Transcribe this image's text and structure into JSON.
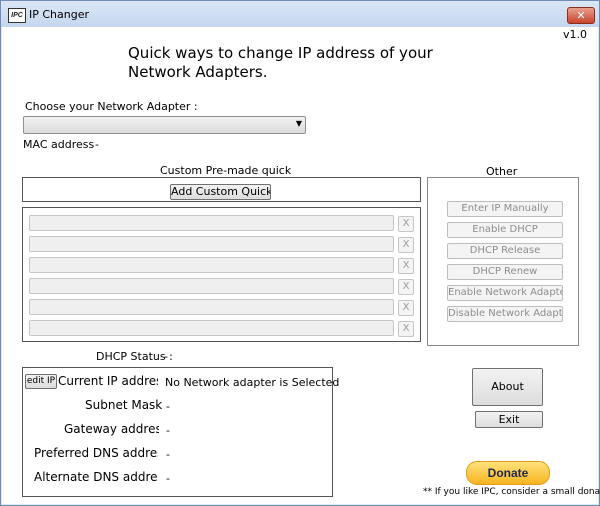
{
  "window": {
    "app_icon_text": "IPC",
    "title": "IP Changer",
    "close_glyph": "✕",
    "version": "v1.0"
  },
  "header": {
    "headline": "Quick ways to change IP address of your Network Adapters."
  },
  "adapter": {
    "choose_label": "Choose your Network Adapter :",
    "selected_value": "",
    "dropdown_arrow": "▼",
    "mac_label": "MAC address",
    "mac_value": "-"
  },
  "quick_panel": {
    "title": "Custom Pre-made quick",
    "add_button": "Add Custom Quick I",
    "slots": [
      {
        "label": "",
        "remove": "X"
      },
      {
        "label": "",
        "remove": "X"
      },
      {
        "label": "",
        "remove": "X"
      },
      {
        "label": "",
        "remove": "X"
      },
      {
        "label": "",
        "remove": "X"
      },
      {
        "label": "",
        "remove": "X"
      }
    ]
  },
  "other_panel": {
    "title": "Other",
    "buttons": [
      "Enter IP Manually",
      "Enable DHCP",
      "DHCP Release",
      "DHCP Renew",
      "Enable Network Adapte",
      "Disable Network Adapt"
    ]
  },
  "status": {
    "dhcp_label": "DHCP Status :",
    "dhcp_value": "-",
    "edit_ip_button": "edit IP",
    "current_ip_label": "Current IP addres",
    "current_ip_value": "No Network adapter is Selected",
    "subnet_label": "Subnet Mask :",
    "subnet_value": "-",
    "gateway_label": "Gateway address",
    "gateway_value": "-",
    "preferred_dns_label": "Preferred DNS addres",
    "preferred_dns_value": "-",
    "alternate_dns_label": "Alternate DNS addres",
    "alternate_dns_value": "-"
  },
  "actions": {
    "about": "About",
    "exit": "Exit",
    "donate": "Donate",
    "donation_note": "** If you like IPC, consider a small donation"
  }
}
